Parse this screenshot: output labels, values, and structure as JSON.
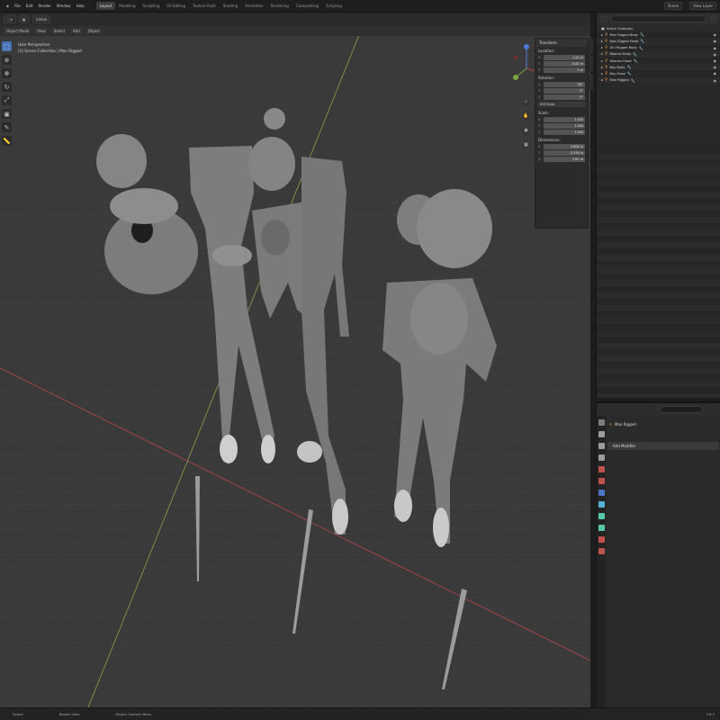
{
  "menubar": {
    "items": [
      "File",
      "Edit",
      "Render",
      "Window",
      "Help"
    ],
    "workspaces": [
      "Layout",
      "Modeling",
      "Sculpting",
      "UV Editing",
      "Texture Paint",
      "Shading",
      "Animation",
      "Rendering",
      "Compositing",
      "Scripting"
    ],
    "active_workspace": "Layout",
    "scene": "Scene",
    "view_layer": "View Layer"
  },
  "viewport": {
    "mode": "Object Mode",
    "menus": [
      "View",
      "Select",
      "Add",
      "Object"
    ],
    "overlay_line1": "User Perspective",
    "overlay_line2": "(1) Scene Collection | Man Rigged",
    "transform_orientation": "Global"
  },
  "npanel": {
    "title": "Transform",
    "location_label": "Location:",
    "location": [
      "1.24 m",
      "-0.82 m",
      "0 m"
    ],
    "rotation_label": "Rotation:",
    "rotation": [
      "90°",
      "0°",
      "0°"
    ],
    "rotation_mode": "XYZ Euler",
    "scale_label": "Scale:",
    "scale": [
      "1.000",
      "1.000",
      "1.000"
    ],
    "dimensions_label": "Dimensions:",
    "dimensions": [
      "0.808 m",
      "0.376 m",
      "1.81 m"
    ],
    "axes": [
      "X",
      "Y",
      "Z"
    ]
  },
  "outliner": {
    "collection": "Scene Collection",
    "objects": [
      "Man Rigged Body",
      "Man Rigged Head",
      "Girl Rigged Body",
      "Woman Body",
      "Woman Head",
      "Boy Body",
      "Boy Head",
      "Man Rigged"
    ]
  },
  "properties": {
    "object_name": "Man Rigged",
    "add_modifier": "Add Modifier"
  },
  "statusbar": {
    "select": "Select",
    "rotate": "Rotate View",
    "context": "Object Context Menu",
    "version": "3.6.1"
  },
  "colors": {
    "viewport_bg": "#3c3c3c",
    "accent": "#4772b3",
    "x_axis": "#a04545",
    "y_axis": "#8aa34a",
    "armature": "#e08a3c",
    "modifier": "#58c6a8"
  }
}
